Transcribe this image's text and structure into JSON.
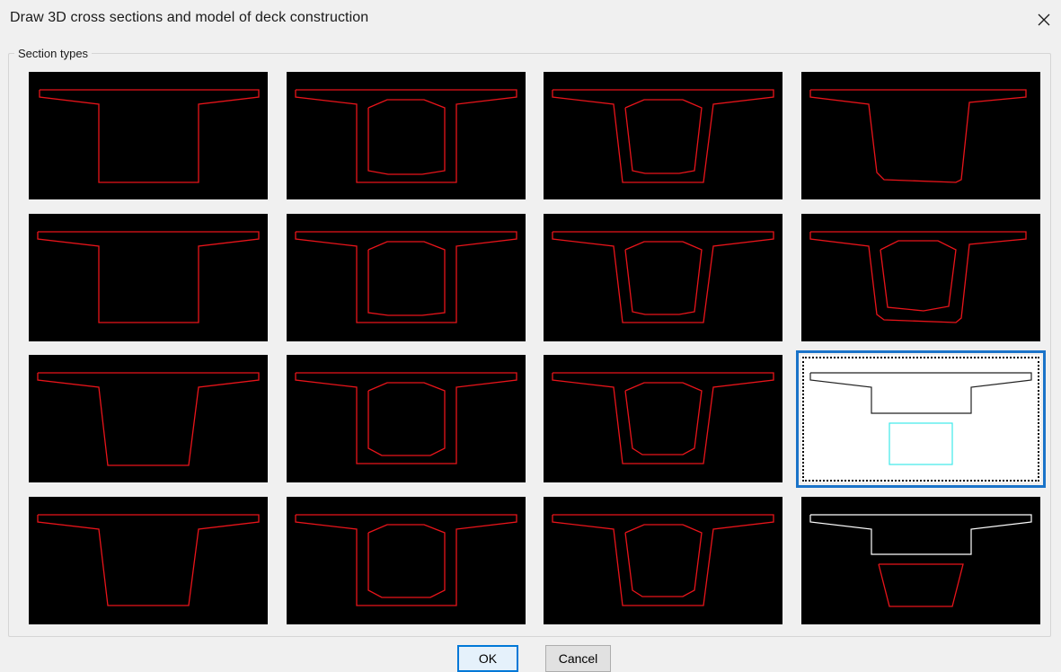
{
  "dialog": {
    "title": "Draw 3D cross sections and model of deck construction",
    "close_icon": "close-icon"
  },
  "section_types": {
    "label": "Section types",
    "selected_index": 11,
    "colors": {
      "outline": "#e8141a",
      "thumb_bg": "#000000",
      "selection": "#1a73c9",
      "inner_box": "#3ee8ea"
    }
  },
  "buttons": {
    "ok": "OK",
    "cancel": "Cancel"
  }
}
